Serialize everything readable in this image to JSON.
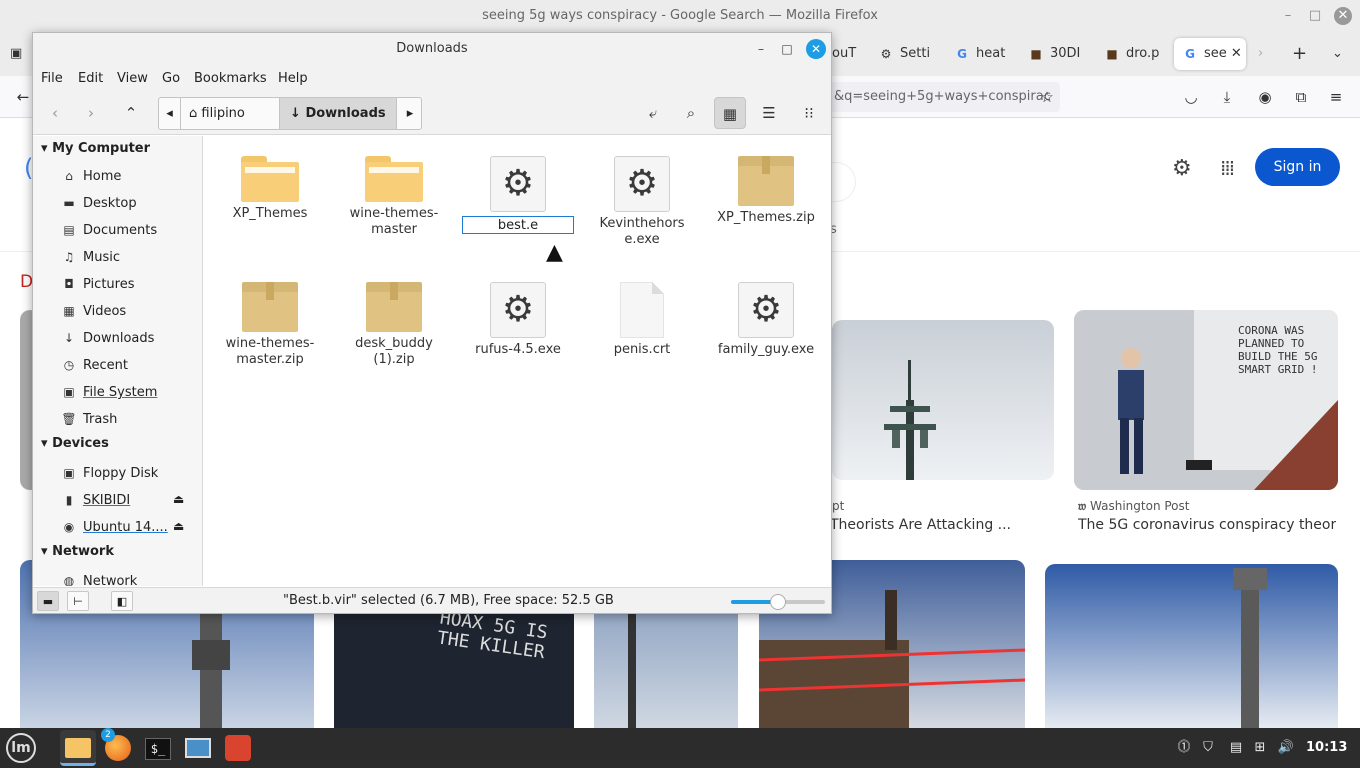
{
  "firefox": {
    "window_title": "seeing 5g ways conspiracy - Google Search — Mozilla Firefox",
    "tabs": [
      {
        "label": "ouT",
        "icon": ""
      },
      {
        "label": "Setti",
        "icon": "⚙"
      },
      {
        "label": "heat",
        "icon": "G"
      },
      {
        "label": "30DI",
        "icon": "■"
      },
      {
        "label": "dro.p",
        "icon": "■"
      },
      {
        "label": "see",
        "icon": "G"
      }
    ],
    "url": "&q=seeing+5g+ways+conspirac",
    "sign_in": "Sign in",
    "partial_letter_d": "D",
    "partial_s": "s",
    "results": [
      {
        "source": "pt",
        "caption": "Theorists Are Attacking ..."
      },
      {
        "source": "Washington Post",
        "caption": "The 5G coronavirus conspiracy theor..."
      }
    ],
    "sign_text": "CORONA WAS PLANNED TO BUILD THE 5G SMART GRID !",
    "wall_text": "HOAX 5G IS THE KILLER"
  },
  "file_manager": {
    "title": "Downloads",
    "menu": [
      "File",
      "Edit",
      "View",
      "Go",
      "Bookmarks",
      "Help"
    ],
    "path": {
      "parent": "filipino",
      "current": "Downloads"
    },
    "sidebar": {
      "my_computer": "My Computer",
      "places": [
        {
          "label": "Home",
          "icon": "⌂"
        },
        {
          "label": "Desktop",
          "icon": "▬"
        },
        {
          "label": "Documents",
          "icon": "▤"
        },
        {
          "label": "Music",
          "icon": "♫"
        },
        {
          "label": "Pictures",
          "icon": "◘"
        },
        {
          "label": "Videos",
          "icon": "▦"
        },
        {
          "label": "Downloads",
          "icon": "↓"
        },
        {
          "label": "Recent",
          "icon": "◷"
        },
        {
          "label": "File System",
          "icon": "▣"
        },
        {
          "label": "Trash",
          "icon": "🗑"
        }
      ],
      "devices_header": "Devices",
      "devices": [
        {
          "label": "Floppy Disk",
          "icon": "▣"
        },
        {
          "label": "SKIBIDI",
          "icon": "▮"
        },
        {
          "label": "Ubuntu 14....",
          "icon": "◉"
        }
      ],
      "network_header": "Network",
      "network": [
        {
          "label": "Network",
          "icon": "◍"
        }
      ]
    },
    "files": [
      {
        "name": "XP_Themes",
        "type": "folder"
      },
      {
        "name": "wine-themes-master",
        "type": "folder"
      },
      {
        "name": "best.e",
        "type": "exe-renaming"
      },
      {
        "name": "Kevinthehorse.exe",
        "type": "exe"
      },
      {
        "name": "XP_Themes.zip",
        "type": "box"
      },
      {
        "name": "wine-themes-master.zip",
        "type": "box"
      },
      {
        "name": "desk_buddy (1).zip",
        "type": "box"
      },
      {
        "name": "rufus-4.5.exe",
        "type": "exe"
      },
      {
        "name": "penis.crt",
        "type": "doc"
      },
      {
        "name": "family_guy.exe",
        "type": "exe"
      }
    ],
    "status": "\"Best.b.vir\" selected (6.7 MB), Free space: 52.5 GB",
    "zoom_level": 0.5
  },
  "taskbar": {
    "clock": "10:13",
    "firefox_badge": "2"
  }
}
